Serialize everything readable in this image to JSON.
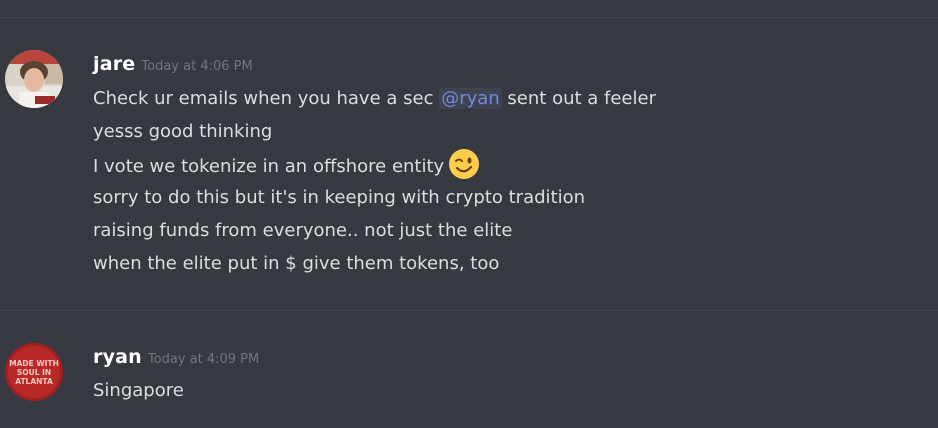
{
  "messages": [
    {
      "username": "jare",
      "timestamp": "Today at 4:06 PM",
      "avatar": "user-photo-avatar",
      "lines": [
        {
          "before": "Check ur emails when you have a sec ",
          "mention": "@ryan",
          "after": " sent out a feeler"
        },
        {
          "text": "yesss good thinking"
        },
        {
          "text": "I vote we tokenize in an offshore entity",
          "emoji": "winking-face-emoji"
        },
        {
          "text": "sorry to do this but it's in keeping with crypto tradition"
        },
        {
          "text": "raising funds from everyone.. not just the elite"
        },
        {
          "text": "when the elite put in $ give them tokens, too"
        }
      ]
    },
    {
      "username": "ryan",
      "timestamp": "Today at 4:09 PM",
      "avatar": "made-with-soul-avatar",
      "avatar_text": [
        "MADE WITH",
        "SOUL IN",
        "ATLANTA"
      ],
      "lines": [
        {
          "text": "Singapore"
        }
      ]
    }
  ],
  "colors": {
    "background": "#36393f",
    "username": "#ffffff",
    "timestamp": "#72767d",
    "text": "#dcddde",
    "mention": "#7289da",
    "divider": "#42454a"
  }
}
